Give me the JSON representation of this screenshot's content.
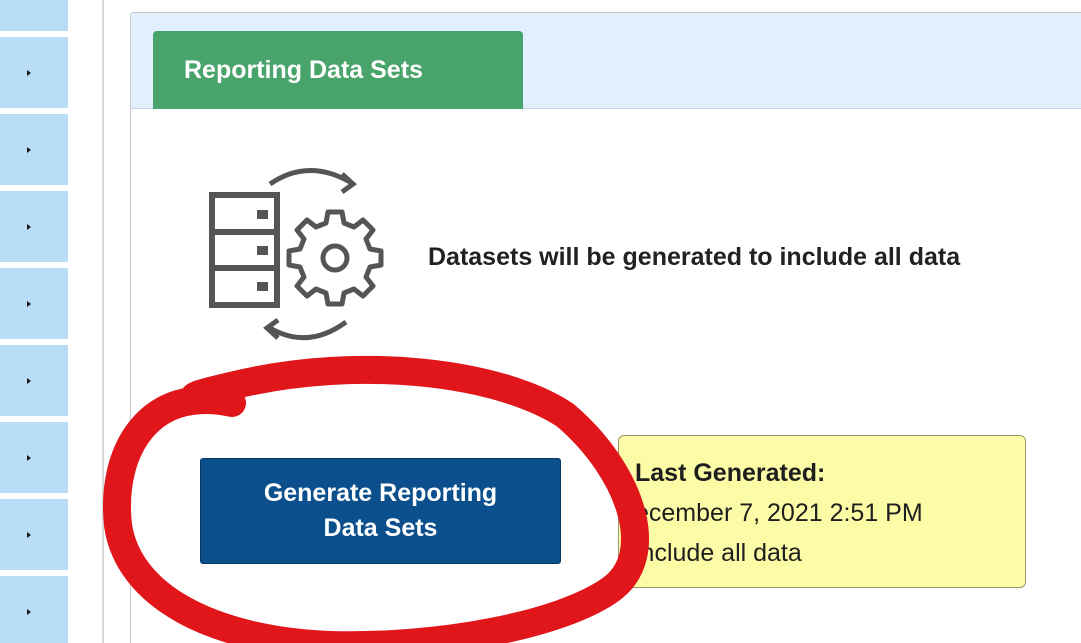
{
  "sidebar": {
    "items": [
      {
        "name": "sidebar-item-1"
      },
      {
        "name": "sidebar-item-2"
      },
      {
        "name": "sidebar-item-3"
      },
      {
        "name": "sidebar-item-4"
      },
      {
        "name": "sidebar-item-5"
      },
      {
        "name": "sidebar-item-6"
      },
      {
        "name": "sidebar-item-7"
      },
      {
        "name": "sidebar-item-8"
      },
      {
        "name": "sidebar-item-9"
      }
    ]
  },
  "panel": {
    "tab_label": "Reporting Data Sets",
    "description": "Datasets will be generated to include all data",
    "icon": "dataset-generation-icon"
  },
  "generate_button": {
    "line1": "Generate Reporting",
    "line2": "Data Sets"
  },
  "info": {
    "label": "Last Generated:",
    "date": "ecember 7, 2021 2:51 PM",
    "note": "include all data"
  },
  "colors": {
    "tab_green": "#48a46a",
    "button_blue": "#0b4f8c",
    "info_yellow": "#fcfca6",
    "annotation_red": "#e0161b",
    "sidebar_blue": "#b9dcf7"
  }
}
